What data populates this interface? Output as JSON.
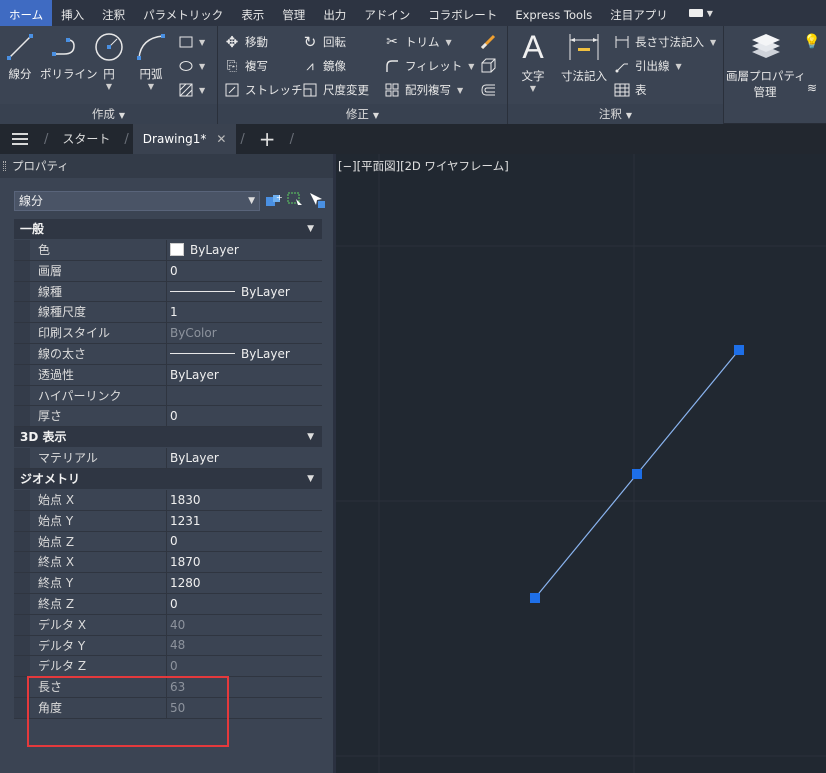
{
  "ribbon_tabs": [
    "ホーム",
    "挿入",
    "注釈",
    "パラメトリック",
    "表示",
    "管理",
    "出力",
    "アドイン",
    "コラボレート",
    "Express Tools",
    "注目アプリ"
  ],
  "create_panel": {
    "title": "作成",
    "line": "線分",
    "polyline": "ポリライン",
    "circle": "円",
    "arc": "円弧"
  },
  "modify_panel": {
    "title": "修正",
    "move": "移動",
    "rotate": "回転",
    "trim": "トリム",
    "copy": "複写",
    "mirror": "鏡像",
    "fillet": "フィレット",
    "stretch": "ストレッチ",
    "scale": "尺度変更",
    "array": "配列複写"
  },
  "annotation_panel": {
    "title": "注釈",
    "text": "文字",
    "dimension": "寸法記入",
    "linear_dim": "長さ寸法記入",
    "leader": "引出線",
    "table": "表"
  },
  "layers_panel": {
    "layer_props": "画層プロパティ",
    "manage": "管理"
  },
  "doc_tabs": {
    "start": "スタート",
    "drawing": "Drawing1*"
  },
  "palette": {
    "title": "プロパティ",
    "selected_object": "線分"
  },
  "sections": {
    "general": "一般",
    "display3d": "3D 表示",
    "geometry": "ジオメトリ"
  },
  "general_props": [
    {
      "name": "色",
      "value": "ByLayer"
    },
    {
      "name": "画層",
      "value": "0"
    },
    {
      "name": "線種",
      "value": "ByLayer"
    },
    {
      "name": "線種尺度",
      "value": "1"
    },
    {
      "name": "印刷スタイル",
      "value": "ByColor"
    },
    {
      "name": "線の太さ",
      "value": "ByLayer"
    },
    {
      "name": "透過性",
      "value": "ByLayer"
    },
    {
      "name": "ハイパーリンク",
      "value": ""
    },
    {
      "name": "厚さ",
      "value": "0"
    }
  ],
  "display3d_props": [
    {
      "name": "マテリアル",
      "value": "ByLayer"
    }
  ],
  "geometry_props": [
    {
      "name": "始点 X",
      "value": "1830"
    },
    {
      "name": "始点 Y",
      "value": "1231"
    },
    {
      "name": "始点 Z",
      "value": "0"
    },
    {
      "name": "終点 X",
      "value": "1870"
    },
    {
      "name": "終点 Y",
      "value": "1280"
    },
    {
      "name": "終点 Z",
      "value": "0"
    },
    {
      "name": "デルタ X",
      "value": "40"
    },
    {
      "name": "デルタ Y",
      "value": "48"
    },
    {
      "name": "デルタ Z",
      "value": "0"
    },
    {
      "name": "長さ",
      "value": "63"
    },
    {
      "name": "角度",
      "value": "50"
    }
  ],
  "viewport_label": "[−][平面図][2D ワイヤフレーム]",
  "colors": {
    "accent": "#3f6bc2",
    "grip": "#1e6fe8",
    "line": "#8ab4f0",
    "highlight": "#e5393c"
  }
}
